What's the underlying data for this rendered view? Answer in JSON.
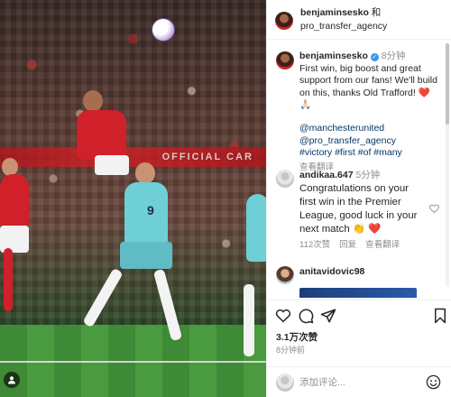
{
  "photo": {
    "ad_text": "OFFICIAL CAR",
    "left_shirt_number": "9"
  },
  "header": {
    "account": "benjaminsesko",
    "joiner": "和",
    "coauthor": "pro_transfer_agency"
  },
  "caption": {
    "username": "benjaminsesko",
    "time": "8分钟",
    "text": "First win, big boost and great support from our fans! We'll build on this, thanks Old Trafford! ❤️ 🙏🏻",
    "mention1": "@manchesterunited",
    "mention2": "@pro_transfer_agency",
    "tags": "#victory #first #of #many",
    "translate": "查看翻译"
  },
  "comments": [
    {
      "username": "andikaa.647",
      "time": "5分钟",
      "text": "Congratulations on your first win in the Premier League, good luck in your next match 👏 ❤️",
      "likes": "112次赞",
      "reply": "回复",
      "translate": "查看翻译"
    },
    {
      "username": "anitavidovic98"
    }
  ],
  "actions": {
    "likes": "3.1万次赞",
    "ago": "8分钟前"
  },
  "add_comment": {
    "placeholder": "添加评论..."
  },
  "colors": {
    "link": "#00376b",
    "muted": "#8e8e8e",
    "united_red": "#d0202a"
  }
}
